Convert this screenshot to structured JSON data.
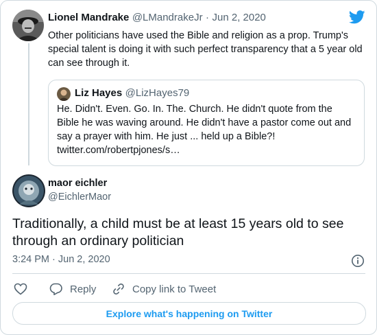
{
  "parent_tweet": {
    "author_name": "Lionel Mandrake",
    "handle": "@LMandrakeJr",
    "separator": "·",
    "date": "Jun 2, 2020",
    "text": "Other politicians have used the Bible and religion as a prop. Trump's special talent is doing it with such perfect transparency that a 5 year old can see through it."
  },
  "quoted_tweet": {
    "author_name": "Liz Hayes",
    "handle": "@LizHayes79",
    "text": "He. Didn't. Even. Go. In. The. Church. He didn't quote from the Bible he was waving around. He didn't have a pastor come out and say a prayer with him. He just ... held up a Bible?! twitter.com/robertpjones/s…"
  },
  "main_tweet": {
    "author_name": "maor eichler",
    "handle": "@EichlerMaor",
    "text": "Traditionally, a child must be at least 15 years old to see through an ordinary politician",
    "timestamp": "3:24 PM · Jun 2, 2020"
  },
  "actions": {
    "reply_label": "Reply",
    "copy_link_label": "Copy link to Tweet"
  },
  "explore_label": "Explore what's happening on Twitter",
  "colors": {
    "brand_blue": "#1d9bf0",
    "text_primary": "#0f1419",
    "text_muted": "#536471",
    "border": "#cfd9de"
  },
  "icons": [
    "twitter-bird-icon",
    "info-icon",
    "heart-icon",
    "reply-icon",
    "link-icon"
  ]
}
